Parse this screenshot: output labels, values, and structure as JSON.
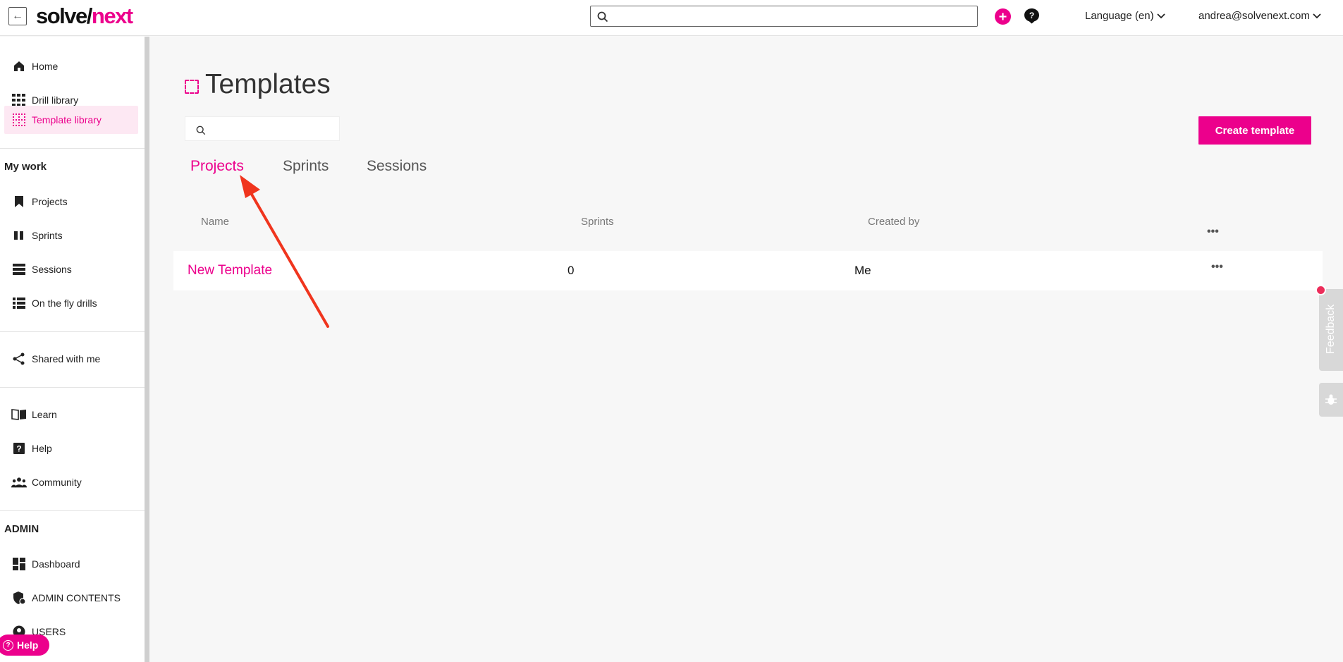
{
  "topbar": {
    "logo_part1": "solve/",
    "logo_part2": "next",
    "search_placeholder": "",
    "language": "Language (en)",
    "user_email": "andrea@solvenext.com"
  },
  "sidebar": {
    "nav": [
      {
        "label": "Home",
        "icon": "home-icon"
      },
      {
        "label": "Drill library",
        "icon": "grid-icon"
      },
      {
        "label": "Template library",
        "icon": "dotted-grid-icon",
        "active": true
      }
    ],
    "my_work_title": "My work",
    "my_work": [
      {
        "label": "Projects",
        "icon": "bookmark-icon"
      },
      {
        "label": "Sprints",
        "icon": "columns-icon"
      },
      {
        "label": "Sessions",
        "icon": "rows-icon"
      },
      {
        "label": "On the fly drills",
        "icon": "list-icon"
      }
    ],
    "shared": {
      "label": "Shared with me",
      "icon": "share-icon"
    },
    "support": [
      {
        "label": "Learn",
        "icon": "book-icon"
      },
      {
        "label": "Help",
        "icon": "question-icon"
      },
      {
        "label": "Community",
        "icon": "people-icon"
      }
    ],
    "admin_title": "ADMIN",
    "admin": [
      {
        "label": "Dashboard",
        "icon": "dashboard-icon"
      },
      {
        "label": "ADMIN CONTENTS",
        "icon": "shield-icon"
      },
      {
        "label": "USERS",
        "icon": "user-icon"
      }
    ],
    "help_pill": "Help"
  },
  "main": {
    "title": "Templates",
    "search_placeholder": "",
    "create_button": "Create template",
    "tabs": [
      "Projects",
      "Sprints",
      "Sessions"
    ],
    "active_tab": "Projects",
    "table": {
      "headers": [
        "Name",
        "Sprints",
        "Created by"
      ],
      "more": "•••",
      "rows": [
        {
          "name": "New Template",
          "sprints": "0",
          "created_by": "Me",
          "more": "•••"
        }
      ]
    }
  },
  "widgets": {
    "feedback": "Feedback"
  },
  "colors": {
    "accent": "#ec008c",
    "annotation_arrow": "#f0351e"
  }
}
